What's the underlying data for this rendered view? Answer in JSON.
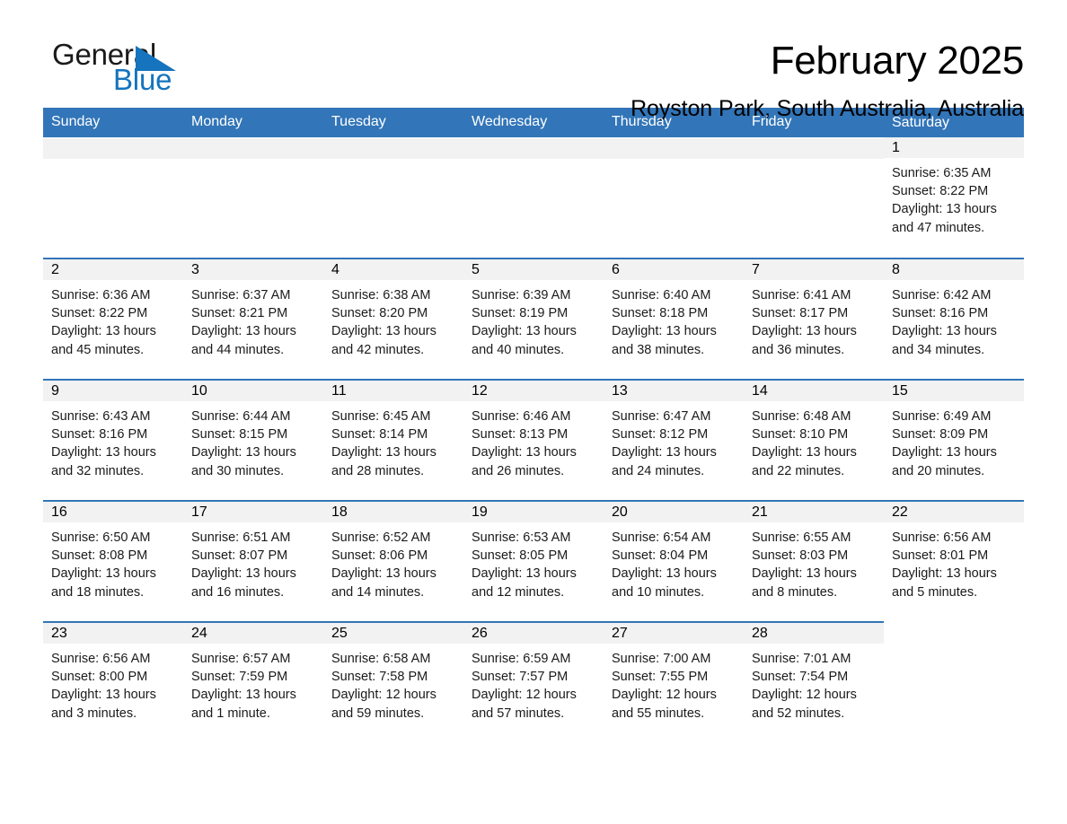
{
  "logo": {
    "word_one": "General",
    "word_two": "Blue",
    "triangle_icon": "triangle-icon",
    "color_blue": "#1574bd",
    "color_dark": "#1a1a1a"
  },
  "header": {
    "title": "February 2025",
    "subtitle": "Royston Park, South Australia, Australia"
  },
  "theme": {
    "header_blue": "#3275b8",
    "row_divider_blue": "#3275b8",
    "daynum_band_gray": "#f2f2f2",
    "text_black": "#000000"
  },
  "weekday_headers": [
    "Sunday",
    "Monday",
    "Tuesday",
    "Wednesday",
    "Thursday",
    "Friday",
    "Saturday"
  ],
  "weeks": [
    {
      "days": [
        {
          "blank": true
        },
        {
          "blank": true
        },
        {
          "blank": true
        },
        {
          "blank": true
        },
        {
          "blank": true
        },
        {
          "blank": true
        },
        {
          "blank": false,
          "date": "1",
          "sunrise": "Sunrise: 6:35 AM",
          "sunset": "Sunset: 8:22 PM",
          "daylight_line1": "Daylight: 13 hours",
          "daylight_line2": "and 47 minutes."
        }
      ]
    },
    {
      "days": [
        {
          "blank": false,
          "date": "2",
          "sunrise": "Sunrise: 6:36 AM",
          "sunset": "Sunset: 8:22 PM",
          "daylight_line1": "Daylight: 13 hours",
          "daylight_line2": "and 45 minutes."
        },
        {
          "blank": false,
          "date": "3",
          "sunrise": "Sunrise: 6:37 AM",
          "sunset": "Sunset: 8:21 PM",
          "daylight_line1": "Daylight: 13 hours",
          "daylight_line2": "and 44 minutes."
        },
        {
          "blank": false,
          "date": "4",
          "sunrise": "Sunrise: 6:38 AM",
          "sunset": "Sunset: 8:20 PM",
          "daylight_line1": "Daylight: 13 hours",
          "daylight_line2": "and 42 minutes."
        },
        {
          "blank": false,
          "date": "5",
          "sunrise": "Sunrise: 6:39 AM",
          "sunset": "Sunset: 8:19 PM",
          "daylight_line1": "Daylight: 13 hours",
          "daylight_line2": "and 40 minutes."
        },
        {
          "blank": false,
          "date": "6",
          "sunrise": "Sunrise: 6:40 AM",
          "sunset": "Sunset: 8:18 PM",
          "daylight_line1": "Daylight: 13 hours",
          "daylight_line2": "and 38 minutes."
        },
        {
          "blank": false,
          "date": "7",
          "sunrise": "Sunrise: 6:41 AM",
          "sunset": "Sunset: 8:17 PM",
          "daylight_line1": "Daylight: 13 hours",
          "daylight_line2": "and 36 minutes."
        },
        {
          "blank": false,
          "date": "8",
          "sunrise": "Sunrise: 6:42 AM",
          "sunset": "Sunset: 8:16 PM",
          "daylight_line1": "Daylight: 13 hours",
          "daylight_line2": "and 34 minutes."
        }
      ]
    },
    {
      "days": [
        {
          "blank": false,
          "date": "9",
          "sunrise": "Sunrise: 6:43 AM",
          "sunset": "Sunset: 8:16 PM",
          "daylight_line1": "Daylight: 13 hours",
          "daylight_line2": "and 32 minutes."
        },
        {
          "blank": false,
          "date": "10",
          "sunrise": "Sunrise: 6:44 AM",
          "sunset": "Sunset: 8:15 PM",
          "daylight_line1": "Daylight: 13 hours",
          "daylight_line2": "and 30 minutes."
        },
        {
          "blank": false,
          "date": "11",
          "sunrise": "Sunrise: 6:45 AM",
          "sunset": "Sunset: 8:14 PM",
          "daylight_line1": "Daylight: 13 hours",
          "daylight_line2": "and 28 minutes."
        },
        {
          "blank": false,
          "date": "12",
          "sunrise": "Sunrise: 6:46 AM",
          "sunset": "Sunset: 8:13 PM",
          "daylight_line1": "Daylight: 13 hours",
          "daylight_line2": "and 26 minutes."
        },
        {
          "blank": false,
          "date": "13",
          "sunrise": "Sunrise: 6:47 AM",
          "sunset": "Sunset: 8:12 PM",
          "daylight_line1": "Daylight: 13 hours",
          "daylight_line2": "and 24 minutes."
        },
        {
          "blank": false,
          "date": "14",
          "sunrise": "Sunrise: 6:48 AM",
          "sunset": "Sunset: 8:10 PM",
          "daylight_line1": "Daylight: 13 hours",
          "daylight_line2": "and 22 minutes."
        },
        {
          "blank": false,
          "date": "15",
          "sunrise": "Sunrise: 6:49 AM",
          "sunset": "Sunset: 8:09 PM",
          "daylight_line1": "Daylight: 13 hours",
          "daylight_line2": "and 20 minutes."
        }
      ]
    },
    {
      "days": [
        {
          "blank": false,
          "date": "16",
          "sunrise": "Sunrise: 6:50 AM",
          "sunset": "Sunset: 8:08 PM",
          "daylight_line1": "Daylight: 13 hours",
          "daylight_line2": "and 18 minutes."
        },
        {
          "blank": false,
          "date": "17",
          "sunrise": "Sunrise: 6:51 AM",
          "sunset": "Sunset: 8:07 PM",
          "daylight_line1": "Daylight: 13 hours",
          "daylight_line2": "and 16 minutes."
        },
        {
          "blank": false,
          "date": "18",
          "sunrise": "Sunrise: 6:52 AM",
          "sunset": "Sunset: 8:06 PM",
          "daylight_line1": "Daylight: 13 hours",
          "daylight_line2": "and 14 minutes."
        },
        {
          "blank": false,
          "date": "19",
          "sunrise": "Sunrise: 6:53 AM",
          "sunset": "Sunset: 8:05 PM",
          "daylight_line1": "Daylight: 13 hours",
          "daylight_line2": "and 12 minutes."
        },
        {
          "blank": false,
          "date": "20",
          "sunrise": "Sunrise: 6:54 AM",
          "sunset": "Sunset: 8:04 PM",
          "daylight_line1": "Daylight: 13 hours",
          "daylight_line2": "and 10 minutes."
        },
        {
          "blank": false,
          "date": "21",
          "sunrise": "Sunrise: 6:55 AM",
          "sunset": "Sunset: 8:03 PM",
          "daylight_line1": "Daylight: 13 hours",
          "daylight_line2": "and 8 minutes."
        },
        {
          "blank": false,
          "date": "22",
          "sunrise": "Sunrise: 6:56 AM",
          "sunset": "Sunset: 8:01 PM",
          "daylight_line1": "Daylight: 13 hours",
          "daylight_line2": "and 5 minutes."
        }
      ]
    },
    {
      "days": [
        {
          "blank": false,
          "date": "23",
          "sunrise": "Sunrise: 6:56 AM",
          "sunset": "Sunset: 8:00 PM",
          "daylight_line1": "Daylight: 13 hours",
          "daylight_line2": "and 3 minutes."
        },
        {
          "blank": false,
          "date": "24",
          "sunrise": "Sunrise: 6:57 AM",
          "sunset": "Sunset: 7:59 PM",
          "daylight_line1": "Daylight: 13 hours",
          "daylight_line2": "and 1 minute."
        },
        {
          "blank": false,
          "date": "25",
          "sunrise": "Sunrise: 6:58 AM",
          "sunset": "Sunset: 7:58 PM",
          "daylight_line1": "Daylight: 12 hours",
          "daylight_line2": "and 59 minutes."
        },
        {
          "blank": false,
          "date": "26",
          "sunrise": "Sunrise: 6:59 AM",
          "sunset": "Sunset: 7:57 PM",
          "daylight_line1": "Daylight: 12 hours",
          "daylight_line2": "and 57 minutes."
        },
        {
          "blank": false,
          "date": "27",
          "sunrise": "Sunrise: 7:00 AM",
          "sunset": "Sunset: 7:55 PM",
          "daylight_line1": "Daylight: 12 hours",
          "daylight_line2": "and 55 minutes."
        },
        {
          "blank": false,
          "date": "28",
          "sunrise": "Sunrise: 7:01 AM",
          "sunset": "Sunset: 7:54 PM",
          "daylight_line1": "Daylight: 12 hours",
          "daylight_line2": "and 52 minutes."
        },
        {
          "blank": true
        }
      ]
    }
  ]
}
